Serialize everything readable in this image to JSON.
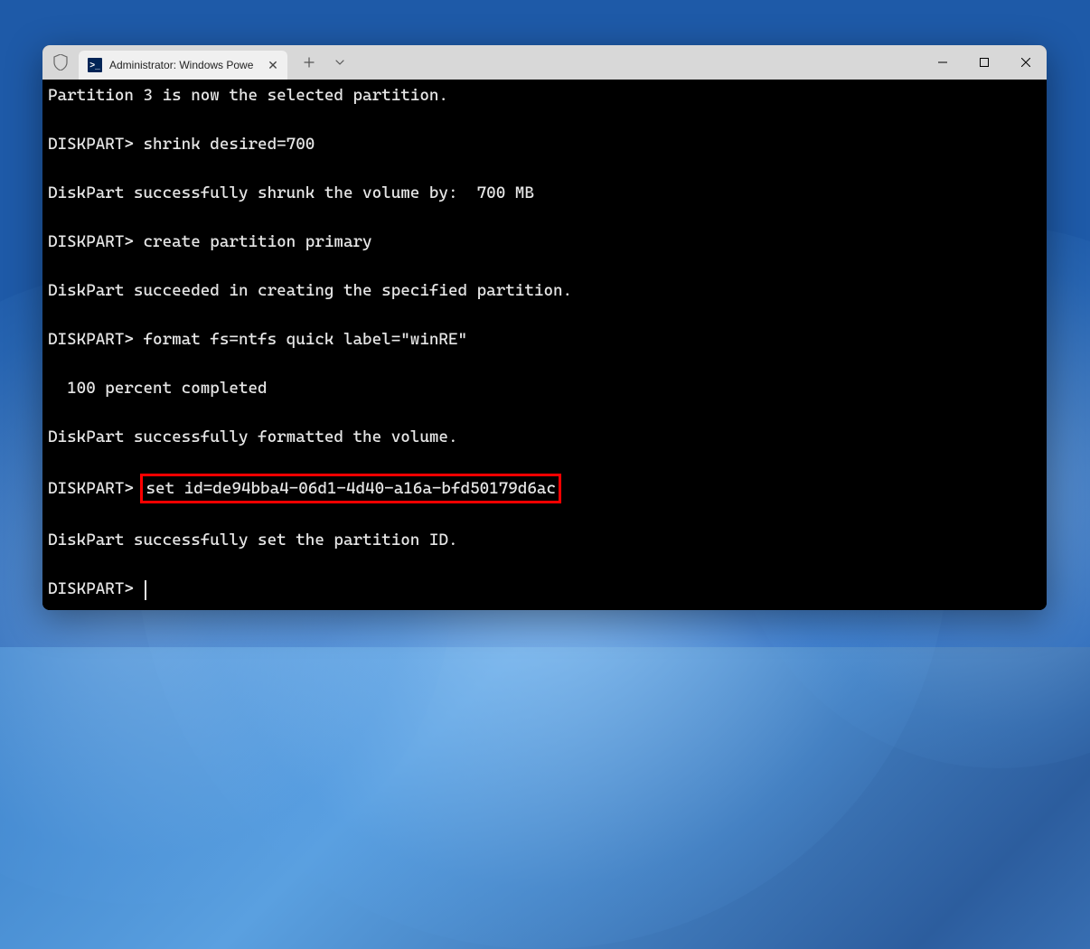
{
  "desktop": {
    "os": "Windows 11"
  },
  "window": {
    "app": "Windows Terminal",
    "tab": {
      "icon_label": ">_",
      "title": "Administrator: Windows Powe",
      "close_glyph": "✕"
    },
    "toolbar": {
      "new_tab_glyph": "+",
      "dropdown_glyph": "⌄"
    },
    "controls": {
      "minimize": "—",
      "maximize": "▢",
      "close": "✕"
    }
  },
  "terminal": {
    "lines": [
      "Partition 3 is now the selected partition.",
      "",
      "DISKPART> shrink desired=700",
      "",
      "DiskPart successfully shrunk the volume by:  700 MB",
      "",
      "DISKPART> create partition primary",
      "",
      "DiskPart succeeded in creating the specified partition.",
      "",
      "DISKPART> format fs=ntfs quick label=\"winRE\"",
      "",
      "  100 percent completed",
      "",
      "DiskPart successfully formatted the volume.",
      ""
    ],
    "highlighted_prompt": "DISKPART> ",
    "highlighted_command": "set id=de94bba4-06d1-4d40-a16a-bfd50179d6ac",
    "after_lines": [
      "",
      "DiskPart successfully set the partition ID.",
      ""
    ],
    "final_prompt": "DISKPART> "
  }
}
